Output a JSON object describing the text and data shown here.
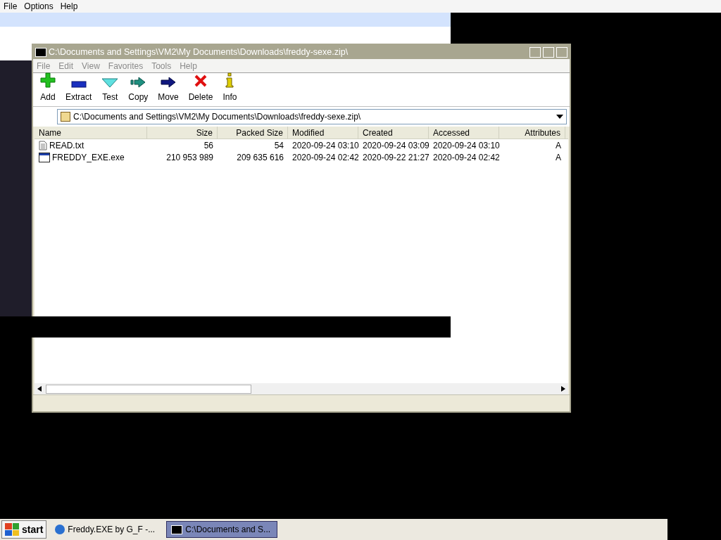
{
  "app_menu": [
    "File",
    "Options",
    "Help"
  ],
  "window": {
    "title": "C:\\Documents and Settings\\VM2\\My Documents\\Downloads\\freddy-sexe.zip\\",
    "menu": [
      "File",
      "Edit",
      "View",
      "Favorites",
      "Tools",
      "Help"
    ],
    "toolbar": [
      {
        "kind": "add",
        "label": "Add"
      },
      {
        "kind": "extract",
        "label": "Extract"
      },
      {
        "kind": "test",
        "label": "Test"
      },
      {
        "kind": "copy",
        "label": "Copy"
      },
      {
        "kind": "move",
        "label": "Move"
      },
      {
        "kind": "delete",
        "label": "Delete"
      },
      {
        "kind": "info",
        "label": "Info"
      }
    ],
    "address": "C:\\Documents and Settings\\VM2\\My Documents\\Downloads\\freddy-sexe.zip\\",
    "columns": [
      "Name",
      "Size",
      "Packed Size",
      "Modified",
      "Created",
      "Accessed",
      "Attributes"
    ],
    "rows": [
      {
        "kind": "text",
        "cells": [
          "READ.txt",
          "56",
          "54",
          "2020-09-24 03:10",
          "2020-09-24 03:09",
          "2020-09-24 03:10",
          "A"
        ]
      },
      {
        "kind": "exe",
        "cells": [
          "FREDDY_EXE.exe",
          "210 953 989",
          "209 635 616",
          "2020-09-24 02:42",
          "2020-09-22 21:27",
          "2020-09-24 02:42",
          "A"
        ]
      }
    ]
  },
  "taskbar": {
    "start": "start",
    "items": [
      {
        "kind": "browser",
        "label": "Freddy.EXE by G_F -...",
        "selected": false
      },
      {
        "kind": "archive",
        "label": "C:\\Documents and S...",
        "selected": true
      }
    ]
  }
}
